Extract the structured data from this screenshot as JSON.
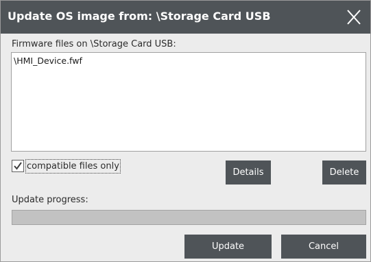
{
  "window": {
    "title": "Update OS image from: \\Storage Card USB"
  },
  "files": {
    "label": "Firmware files on \\Storage Card USB:",
    "items": [
      "\\HMI_Device.fwf"
    ]
  },
  "filter": {
    "label": "compatible files only",
    "checked": true
  },
  "buttons": {
    "details": "Details",
    "delete": "Delete",
    "update": "Update",
    "cancel": "Cancel"
  },
  "progress": {
    "label": "Update progress:",
    "value": 0
  },
  "colors": {
    "titlebar": "#4f5458",
    "button": "#4f5458",
    "background": "#ececec",
    "progress_track": "#c2c2c2"
  },
  "icons": {
    "close": "close-icon",
    "check": "check-icon"
  }
}
